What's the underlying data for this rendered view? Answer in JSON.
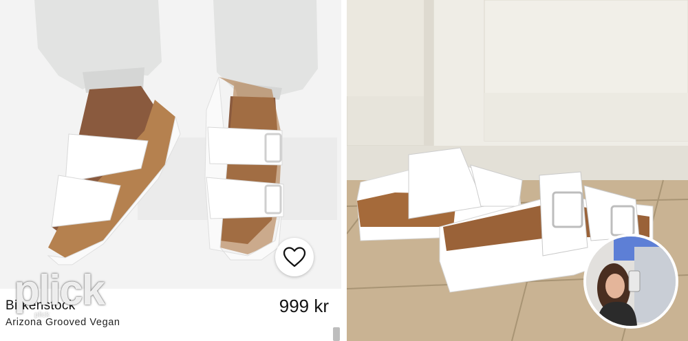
{
  "listing": {
    "brand": "Birkenstock",
    "model": "Arizona Grooved Vegan",
    "price": "999 kr"
  },
  "overlay": {
    "watermark": "plick",
    "watermark_sub": "plick"
  },
  "icons": {
    "favorite": "heart-outline-icon"
  },
  "colors": {
    "background": "#ffffff",
    "text": "#111111"
  }
}
